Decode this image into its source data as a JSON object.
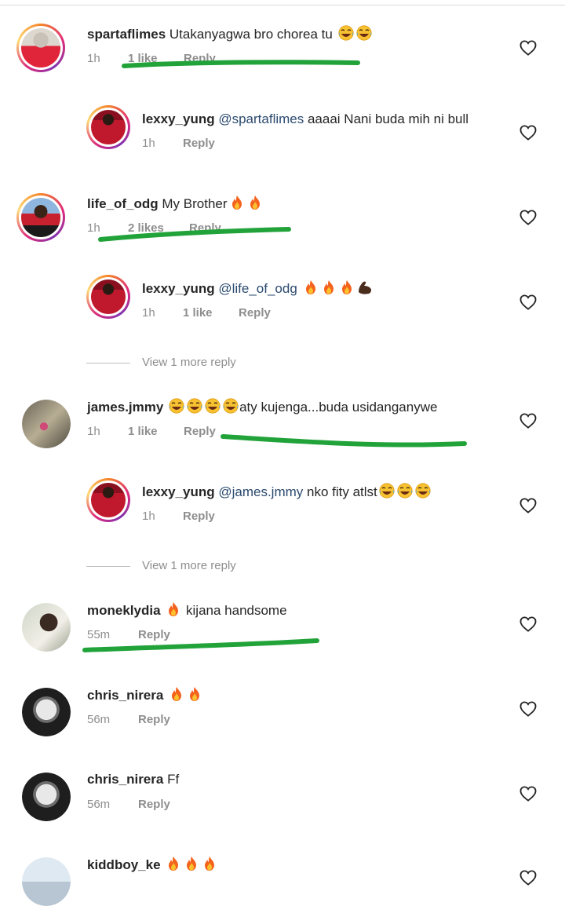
{
  "comments": [
    {
      "user": "spartaflimes",
      "text": " Utakanyagwa bro chorea tu ",
      "emoji": "😂😂",
      "time": "1h",
      "likes": "1 like",
      "reply": "Reply"
    },
    {
      "user": "lexxy_yung",
      "mention": "@spartaflimes",
      "text": " aaaai Nani buda mih ni bull",
      "time": "1h",
      "reply": "Reply"
    },
    {
      "user": "life_of_odg",
      "text": " My Brother",
      "emoji": "🔥🔥",
      "time": "1h",
      "likes": "2 likes",
      "reply": "Reply"
    },
    {
      "user": "lexxy_yung",
      "mention": "@life_of_odg",
      "text": " ",
      "emoji": "🔥🔥🔥💪🏿",
      "time": "1h",
      "likes": "1 like",
      "reply": "Reply",
      "view_more": "View 1 more reply"
    },
    {
      "user": "james.jmmy",
      "text": "aty kujenga...buda usidanganywe",
      "emoji": "😂😂😂😂",
      "time": "1h",
      "likes": "1 like",
      "reply": "Reply"
    },
    {
      "user": "lexxy_yung",
      "mention": "@james.jmmy",
      "text": " nko fity atlst",
      "emoji": "😂😂😂",
      "time": "1h",
      "reply": "Reply",
      "view_more": "View 1 more reply"
    },
    {
      "user": "moneklydia",
      "text": "kijana handsome",
      "emoji": "🔥",
      "time": "55m",
      "reply": "Reply"
    },
    {
      "user": "chris_nirera",
      "text": "",
      "emoji": "🔥🔥",
      "time": "56m",
      "reply": "Reply"
    },
    {
      "user": "chris_nirera",
      "text": " Ff",
      "time": "56m",
      "reply": "Reply"
    },
    {
      "user": "kiddboy_ke",
      "text": "",
      "emoji": "🔥🔥🔥",
      "time": "",
      "reply": ""
    }
  ]
}
